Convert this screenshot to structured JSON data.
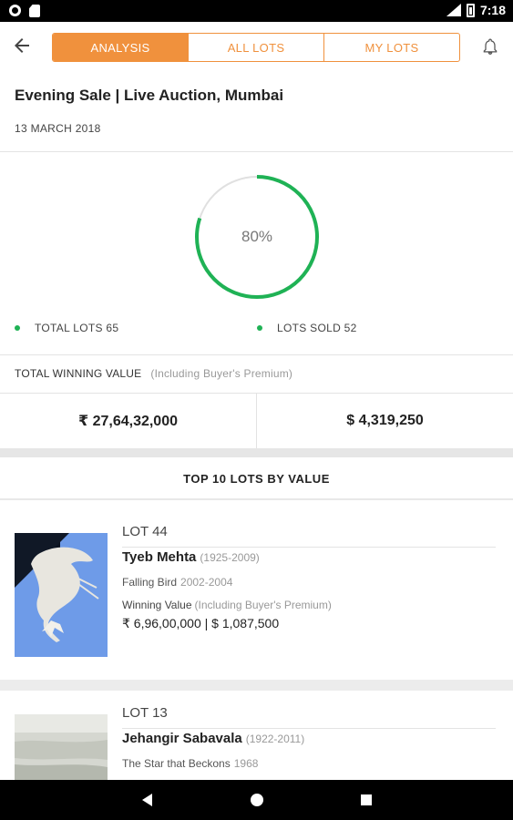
{
  "status_bar": {
    "time": "7:18",
    "network": "LTE"
  },
  "header": {
    "back_icon": "arrow-left-icon",
    "tabs": [
      {
        "label": "ANALYSIS",
        "active": true
      },
      {
        "label": "ALL LOTS",
        "active": false
      },
      {
        "label": "MY LOTS",
        "active": false
      }
    ],
    "bell_icon": "bell-icon"
  },
  "sale": {
    "title": "Evening Sale | Live Auction, Mumbai",
    "date": "13 MARCH 2018"
  },
  "analysis": {
    "percent_label": "80%",
    "percent_value": 80,
    "ring_color": "#1fb255",
    "total_lots_label": "TOTAL LOTS 65",
    "lots_sold_label": "LOTS SOLD 52"
  },
  "winning": {
    "label": "TOTAL WINNING VALUE",
    "note": "(Including Buyer's Premium)",
    "inr": "₹ 27,64,32,000",
    "usd": "$ 4,319,250"
  },
  "top10": {
    "heading": "TOP 10 LOTS BY VALUE"
  },
  "lots": [
    {
      "lot_no": "LOT 44",
      "artist": "Tyeb Mehta",
      "years": "(1925-2009)",
      "title": "Falling Bird",
      "work_years": "2002-2004",
      "wv_label": "Winning Value",
      "wv_note": "(Including Buyer's Premium)",
      "price": "₹ 6,96,00,000 | $ 1,087,500"
    },
    {
      "lot_no": "LOT 13",
      "artist": "Jehangir Sabavala",
      "years": "(1922-2011)",
      "title": "The Star that Beckons",
      "work_years": "1968"
    }
  ],
  "colors": {
    "accent": "#f0913d",
    "success": "#1fb255"
  }
}
